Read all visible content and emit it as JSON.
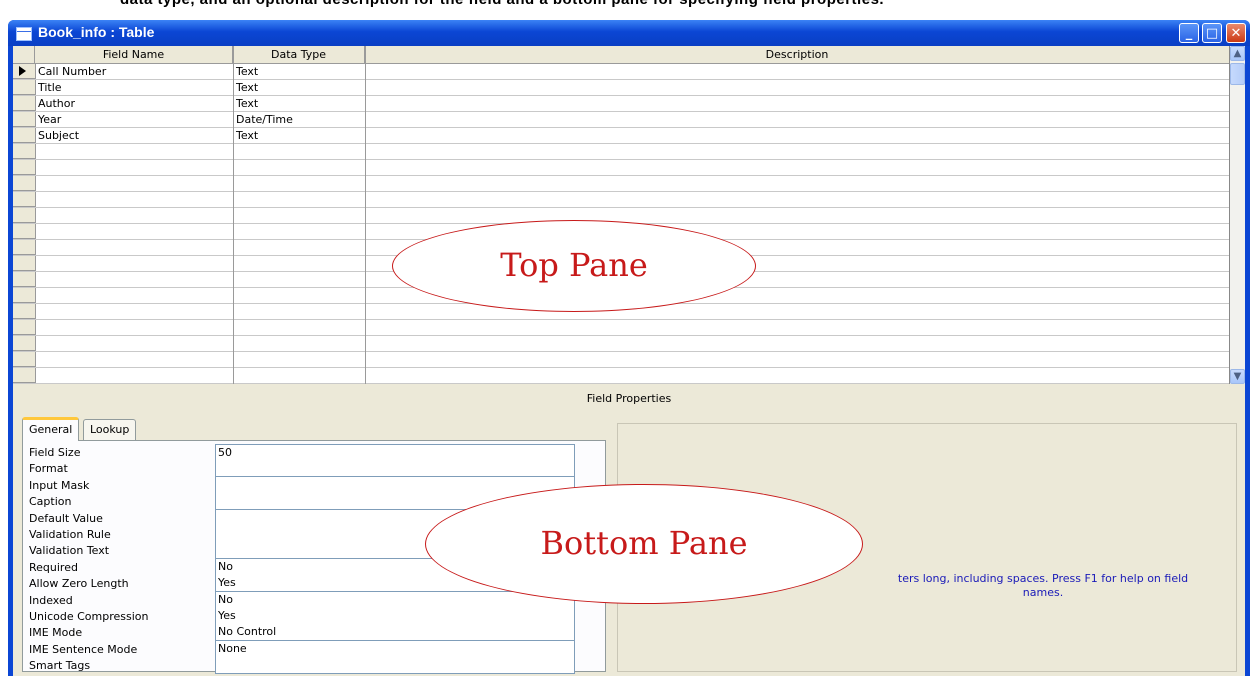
{
  "caption_strip": "data type, and an optional description for the field and a bottom pane for specifying field properties.",
  "window": {
    "title": "Book_info : Table",
    "controls": {
      "minimize": "minimize-icon",
      "maximize": "maximize-icon",
      "close": "close-icon"
    }
  },
  "grid": {
    "headers": {
      "field_name": "Field Name",
      "data_type": "Data Type",
      "description": "Description"
    },
    "rows": [
      {
        "field": "Call Number",
        "type": "Text"
      },
      {
        "field": "Title",
        "type": "Text"
      },
      {
        "field": "Author",
        "type": "Text"
      },
      {
        "field": "Year",
        "type": "Date/Time"
      },
      {
        "field": "Subject",
        "type": "Text"
      }
    ]
  },
  "field_properties": {
    "label": "Field Properties",
    "tabs": [
      "General",
      "Lookup"
    ],
    "properties": [
      {
        "label": "Field Size",
        "value": "50"
      },
      {
        "label": "Format",
        "value": ""
      },
      {
        "label": "Input Mask",
        "value": ""
      },
      {
        "label": "Caption",
        "value": ""
      },
      {
        "label": "Default Value",
        "value": ""
      },
      {
        "label": "Validation Rule",
        "value": ""
      },
      {
        "label": "Validation Text",
        "value": ""
      },
      {
        "label": "Required",
        "value": "No"
      },
      {
        "label": "Allow Zero Length",
        "value": "Yes"
      },
      {
        "label": "Indexed",
        "value": "No"
      },
      {
        "label": "Unicode Compression",
        "value": "Yes"
      },
      {
        "label": "IME Mode",
        "value": "No Control"
      },
      {
        "label": "IME Sentence Mode",
        "value": "None"
      },
      {
        "label": "Smart Tags",
        "value": ""
      }
    ],
    "help_text_line1": "ters long, including spaces.  Press F1 for help on field",
    "help_text_line2": "names."
  },
  "annotations": {
    "top": "Top Pane",
    "bottom": "Bottom Pane"
  }
}
